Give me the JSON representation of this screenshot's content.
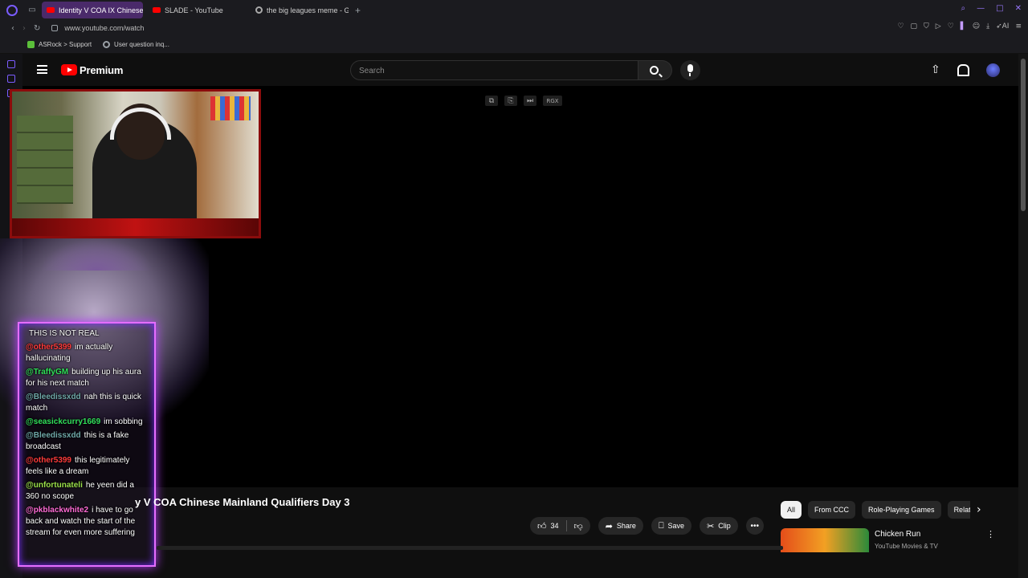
{
  "browser": {
    "tabs": [
      {
        "label": "Identity V COA IX Chinese",
        "favicon": "youtube-icon",
        "active": true
      },
      {
        "label": "SLADE - YouTube",
        "favicon": "youtube-icon",
        "active": false
      },
      {
        "label": "the big leagues meme - Go",
        "favicon": "google-icon",
        "active": false
      }
    ],
    "url": "www.youtube.com/watch",
    "bookmarks": [
      {
        "label": "ASRock > Support",
        "icon": "asrock-icon"
      },
      {
        "label": "User question inq...",
        "icon": "globe-icon"
      }
    ],
    "toolbar_ai_label": "AI",
    "accent": "#7a5cff"
  },
  "youtube": {
    "brand": "Premium",
    "search_placeholder": "Search",
    "video_title": "y V COA   Chinese Mainland Qualifiers Day 3",
    "likes": "34",
    "actions": {
      "share": "Share",
      "save": "Save",
      "clip": "Clip"
    },
    "chips": [
      "All",
      "From CCC",
      "Role-Playing Games",
      "Relat"
    ],
    "recommendation": {
      "title": "Chicken Run",
      "channel": "YouTube Movies & TV"
    },
    "player_overlay_label": "RGX"
  },
  "chat": [
    {
      "user": "",
      "text": "THIS IS NOT REAL",
      "color": "#ffffff"
    },
    {
      "user": "@other5399",
      "text": "im actually hallucinating",
      "color": "#ff3b3b"
    },
    {
      "user": "@TraffyGM",
      "text": "building up his aura for his next match",
      "color": "#31e05a"
    },
    {
      "user": "@Bleedissxdd",
      "text": "nah this is quick match",
      "color": "#6fa8a8"
    },
    {
      "user": "@seasickcurry1669",
      "text": "im sobbing",
      "color": "#31e05a"
    },
    {
      "user": "@Bleedissxdd",
      "text": "this is a fake broadcast",
      "color": "#6fa8a8"
    },
    {
      "user": "@other5399",
      "text": "this legitimately feels like a dream",
      "color": "#ff3b3b"
    },
    {
      "user": "@unfortunateli",
      "text": "he yeen did a 360 no scope",
      "color": "#9be04a"
    },
    {
      "user": "@pkblackwhite2",
      "text": "i have to go back and watch the start of the stream for even more suffering",
      "color": "#ff6bd6"
    }
  ]
}
